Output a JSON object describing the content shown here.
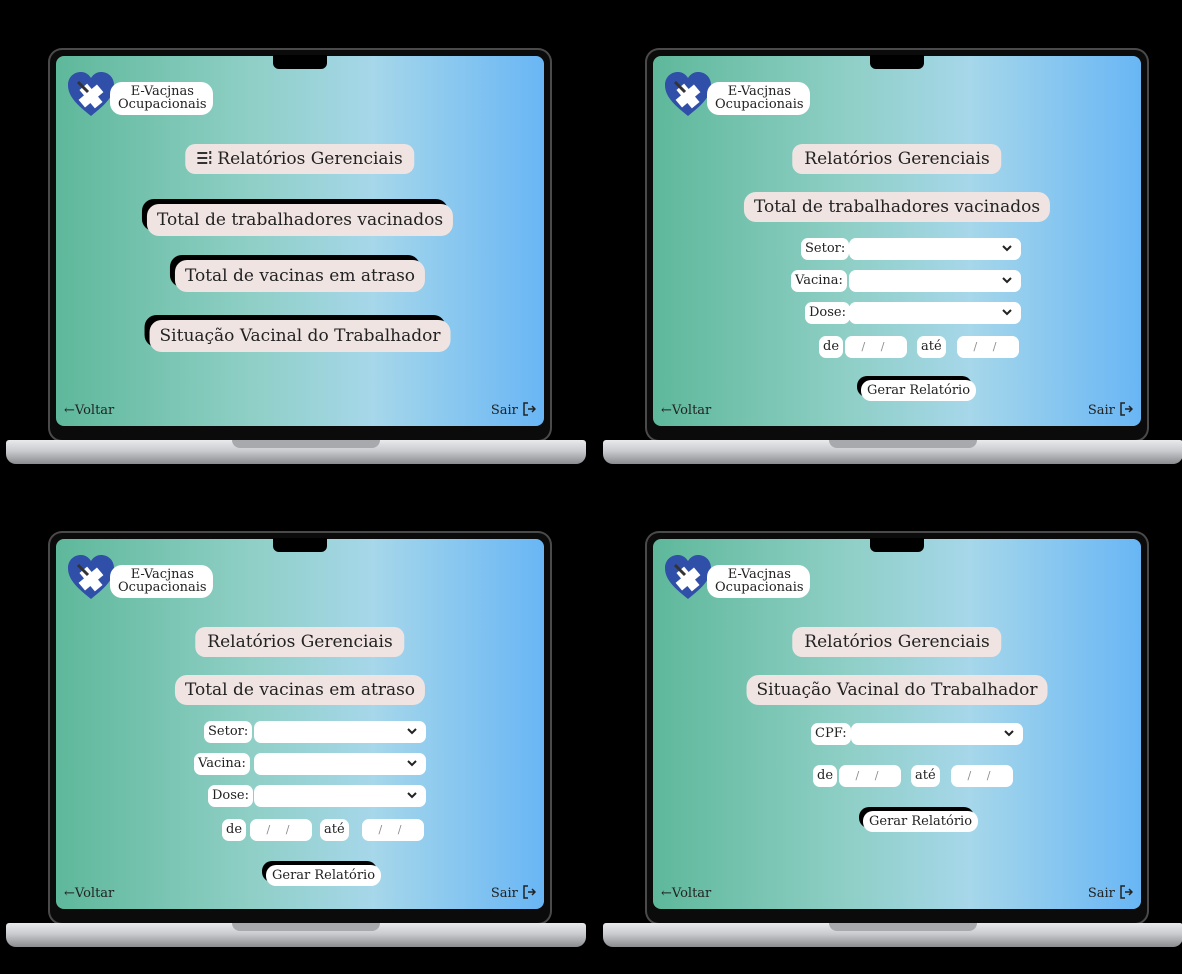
{
  "app": {
    "logo_line1": "E-Vacjnas",
    "logo_line2": "Ocupacionais",
    "footer_back": "←Voltar",
    "footer_exit": "Sair"
  },
  "colors": {
    "gradient_left": "#5eb89a",
    "gradient_right": "#69b6f5",
    "pill_bg": "#efe4e2",
    "heart": "#2f4fa8"
  },
  "icons": {
    "logo": "heart-syringe-icon",
    "menu": "list-menu-icon",
    "dropdown": "chevron-down-icon",
    "exit": "exit-icon"
  },
  "screen1": {
    "title": "Relatórios Gerenciais",
    "menu": [
      {
        "label": "Total de trabalhadores vacinados"
      },
      {
        "label": "Total de vacinas em atraso"
      },
      {
        "label": "Situação Vacinal do Trabalhador"
      }
    ]
  },
  "screen2": {
    "title": "Relatórios Gerenciais",
    "subtitle": "Total de trabalhadores vacinados",
    "fields": {
      "setor": "Setor:",
      "vacina": "Vacina:",
      "dose": "Dose:"
    },
    "date_from_label": "de",
    "date_to_label": "até",
    "date_placeholder": "/ /",
    "button": "Gerar Relatório"
  },
  "screen3": {
    "title": "Relatórios Gerenciais",
    "subtitle": "Total de vacinas em atraso",
    "fields": {
      "setor": "Setor:",
      "vacina": "Vacina:",
      "dose": "Dose:"
    },
    "date_from_label": "de",
    "date_to_label": "até",
    "date_placeholder": "/ /",
    "button": "Gerar Relatório"
  },
  "screen4": {
    "title": "Relatórios Gerenciais",
    "subtitle": "Situação Vacinal do Trabalhador",
    "fields": {
      "cpf": "CPF:"
    },
    "date_from_label": "de",
    "date_to_label": "até",
    "date_placeholder": "/ /",
    "button": "Gerar Relatório"
  }
}
